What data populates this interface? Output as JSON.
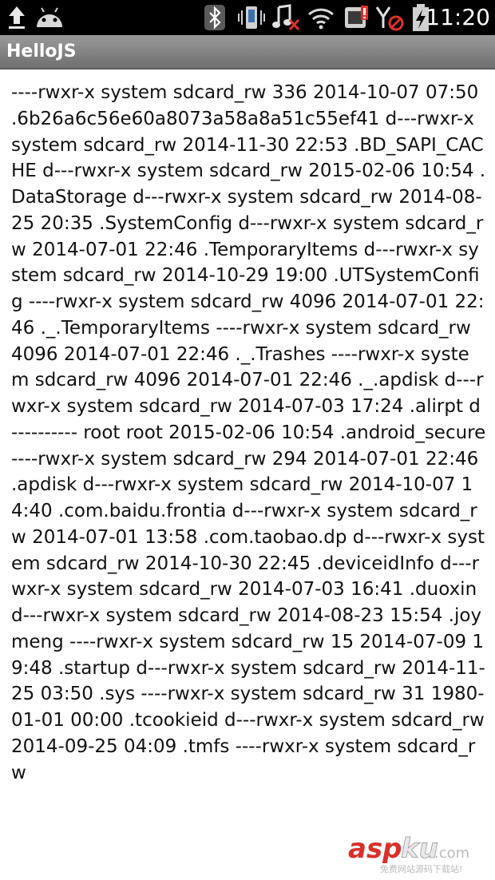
{
  "status_bar": {
    "time": "11:20",
    "icons": [
      "upload-icon",
      "android-icon",
      "bluetooth-icon",
      "vibrate-icon",
      "music-muted-icon",
      "wifi-icon",
      "sim-icon",
      "no-signal-icon",
      "battery-charging-icon"
    ]
  },
  "app": {
    "title": "HelloJS"
  },
  "content": {
    "text": "----rwxr-x system sdcard_rw 336 2014-10-07 07:50 .6b26a6c56e60a8073a58a8a51c55ef41 d---rwxr-x system sdcard_rw 2014-11-30 22:53 .BD_SAPI_CACHE d---rwxr-x system sdcard_rw 2015-02-06 10:54 .DataStorage d---rwxr-x system sdcard_rw 2014-08-25 20:35 .SystemConfig d---rwxr-x system sdcard_rw 2014-07-01 22:46 .TemporaryItems d---rwxr-x system sdcard_rw 2014-10-29 19:00 .UTSystemConfig ----rwxr-x system sdcard_rw 4096 2014-07-01 22:46 ._.TemporaryItems ----rwxr-x system sdcard_rw 4096 2014-07-01 22:46 ._.Trashes ----rwxr-x system sdcard_rw 4096 2014-07-01 22:46 ._.apdisk d---rwxr-x system sdcard_rw 2014-07-03 17:24 .alirpt d---------- root root 2015-02-06 10:54 .android_secure ----rwxr-x system sdcard_rw 294 2014-07-01 22:46 .apdisk d---rwxr-x system sdcard_rw 2014-10-07 14:40 .com.baidu.frontia d---rwxr-x system sdcard_rw 2014-07-01 13:58 .com.taobao.dp d---rwxr-x system sdcard_rw 2014-10-30 22:45 .deviceidInfo d---rwxr-x system sdcard_rw 2014-07-03 16:41 .duoxin d---rwxr-x system sdcard_rw 2014-08-23 15:54 .joymeng ----rwxr-x system sdcard_rw 15 2014-07-09 19:48 .startup d---rwxr-x system sdcard_rw 2014-11-25 03:50 .sys ----rwxr-x system sdcard_rw 31 1980-01-01 00:00 .tcookieid d---rwxr-x system sdcard_rw 2014-09-25 04:09 .tmfs ----rwxr-x system sdcard_rw"
  },
  "watermark": {
    "brand": "asp",
    "brand2": "ku",
    "suffix": ".com",
    "tagline": "免费网站源码下载站!"
  }
}
